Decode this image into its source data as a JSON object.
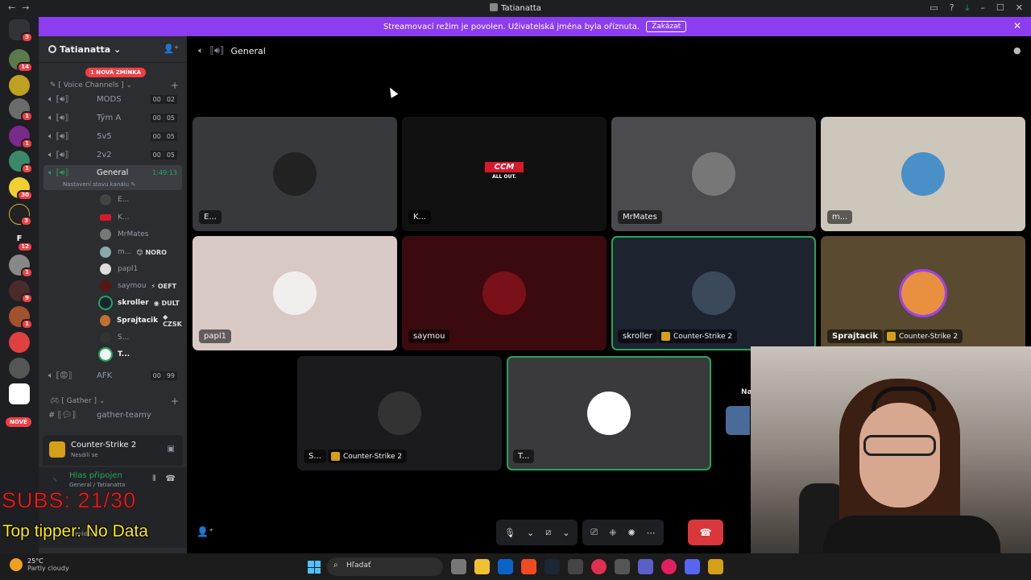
{
  "window": {
    "title": "Tatianatta"
  },
  "banner": {
    "text": "Streamovací režim je povolen. Uživatelská jména byla oříznuta.",
    "button": "Zakázat"
  },
  "rail": {
    "badges": [
      "3",
      "14",
      "1",
      "1",
      "1",
      "30",
      "3",
      "12",
      "1",
      "9",
      "1"
    ],
    "new_label": "NOVÉ"
  },
  "guild": {
    "name": "Tatianatta",
    "mention_pill": "1 NOVÁ ZMÍNKA"
  },
  "categories": {
    "voice": "[ Voice Channels ]",
    "gather": "[ Gather ]"
  },
  "channels": [
    {
      "name": "MODS",
      "count_a": "00",
      "count_b": "02"
    },
    {
      "name": "Tým A",
      "count_a": "00",
      "count_b": "05"
    },
    {
      "name": "5v5",
      "count_a": "00",
      "count_b": "05"
    },
    {
      "name": "2v2",
      "count_a": "00",
      "count_b": "05"
    },
    {
      "name": "General",
      "timer": "1:49:13",
      "status": "Nastavení stavu kanálu"
    },
    {
      "name": "AFK",
      "count_a": "00",
      "count_b": "99"
    },
    {
      "name": "gather-teamy"
    }
  ],
  "voice_users": [
    {
      "name": "E..."
    },
    {
      "name": "K..."
    },
    {
      "name": "MrMates"
    },
    {
      "name": "m...",
      "tag": "NORO"
    },
    {
      "name": "papl1"
    },
    {
      "name": "saymou",
      "tag": "OEFT"
    },
    {
      "name": "skroller",
      "tag": "DULT"
    },
    {
      "name": "Sprajtacik",
      "tag": "CZSK"
    },
    {
      "name": "S..."
    },
    {
      "name": "T..."
    }
  ],
  "activity": {
    "game": "Counter-Strike 2",
    "status": "Nesdílí se"
  },
  "voice_panel": {
    "status": "Hlas připojen",
    "location": "General / Tatianatta",
    "user_status": "Neviditelný"
  },
  "overlay": {
    "subs": "SUBS: 21/30",
    "tipper": "Top tipper: No Data"
  },
  "stage": {
    "channel": "General"
  },
  "tiles": [
    {
      "label": "E..."
    },
    {
      "label": "K..."
    },
    {
      "label": "MrMates"
    },
    {
      "label": "m..."
    },
    {
      "label": "papl1"
    },
    {
      "label": "saymou"
    },
    {
      "label": "skroller",
      "game": "Counter-Strike 2"
    },
    {
      "label": "Sprajtacik",
      "game": "Counter-Strike 2"
    },
    {
      "label": "S...",
      "game": "Counter-Strike 2"
    },
    {
      "label": "T..."
    }
  ],
  "ccm_logo": {
    "brand": "CCM",
    "tagline": "ALL OUT."
  },
  "tile_partial_text": "Na",
  "taskbar": {
    "temp": "25°C",
    "weather": "Partly cloudy",
    "search": "Hľadať"
  },
  "colors": {
    "brand": "#8c3df0",
    "speaking": "#23a55a",
    "danger": "#da373c",
    "badge": "#f23f43"
  }
}
